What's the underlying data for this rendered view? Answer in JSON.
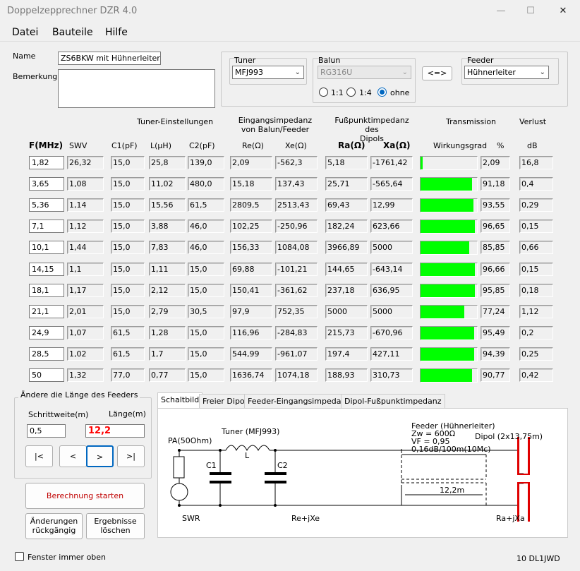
{
  "window": {
    "title": "Doppelzepprechner DZR 4.0",
    "min": "—",
    "max": "☐",
    "close": "✕"
  },
  "menu": [
    "Datei",
    "Bauteile",
    "Hilfe"
  ],
  "form": {
    "name_label": "Name",
    "name_value": "ZS6BKW mit Hühnerleiter.dzr",
    "remark_label": "Bemerkung",
    "remark_value": "",
    "tuner_label": "Tuner",
    "tuner_value": "MFJ993",
    "balun_label": "Balun",
    "balun_value": "RG316U",
    "balun_options": [
      "1:1",
      "1:4",
      "ohne"
    ],
    "balun_selected": "ohne",
    "swap_label": "<=>",
    "feeder_label": "Feeder",
    "feeder_value": "Hühnerleiter"
  },
  "group_headers": {
    "tuner": "Tuner-Einstellungen",
    "input_imp": "Eingangsimpedanz\nvon Balun/Feeder",
    "foot_imp": "Fußpunktimpedanz des\nDipols",
    "transmission": "Transmission",
    "loss": "Verlust"
  },
  "columns": [
    "F(MHz)",
    "SWV",
    "C1(pF)",
    "L(µH)",
    "C2(pF)",
    "Re(Ω)",
    "Xe(Ω)",
    "Ra(Ω)",
    "Xa(Ω)",
    "Wirkungsgrad",
    "%",
    "dB"
  ],
  "rows": [
    {
      "f": "1,82",
      "swv": "26,32",
      "c1": "15,0",
      "l": "25,8",
      "c2": "139,0",
      "re": "2,09",
      "xe": "-562,3",
      "ra": "5,18",
      "xa": "-1761,42",
      "eff": 2.09,
      "pct": "2,09",
      "db": "16,8"
    },
    {
      "f": "3,65",
      "swv": "1,08",
      "c1": "15,0",
      "l": "11,02",
      "c2": "480,0",
      "re": "15,18",
      "xe": "137,43",
      "ra": "25,71",
      "xa": "-565,64",
      "eff": 91.18,
      "pct": "91,18",
      "db": "0,4"
    },
    {
      "f": "5,36",
      "swv": "1,14",
      "c1": "15,0",
      "l": "15,56",
      "c2": "61,5",
      "re": "2809,5",
      "xe": "2513,43",
      "ra": "69,43",
      "xa": "12,99",
      "eff": 93.55,
      "pct": "93,55",
      "db": "0,29"
    },
    {
      "f": "7,1",
      "swv": "1,12",
      "c1": "15,0",
      "l": "3,88",
      "c2": "46,0",
      "re": "102,25",
      "xe": "-250,96",
      "ra": "182,24",
      "xa": "623,66",
      "eff": 96.65,
      "pct": "96,65",
      "db": "0,15"
    },
    {
      "f": "10,1",
      "swv": "1,44",
      "c1": "15,0",
      "l": "7,83",
      "c2": "46,0",
      "re": "156,33",
      "xe": "1084,08",
      "ra": "3966,89",
      "xa": "5000",
      "eff": 85.85,
      "pct": "85,85",
      "db": "0,66"
    },
    {
      "f": "14,15",
      "swv": "1,1",
      "c1": "15,0",
      "l": "1,11",
      "c2": "15,0",
      "re": "69,88",
      "xe": "-101,21",
      "ra": "144,65",
      "xa": "-643,14",
      "eff": 96.66,
      "pct": "96,66",
      "db": "0,15"
    },
    {
      "f": "18,1",
      "swv": "1,17",
      "c1": "15,0",
      "l": "2,12",
      "c2": "15,0",
      "re": "150,41",
      "xe": "-361,62",
      "ra": "237,18",
      "xa": "636,95",
      "eff": 95.85,
      "pct": "95,85",
      "db": "0,18"
    },
    {
      "f": "21,1",
      "swv": "2,01",
      "c1": "15,0",
      "l": "2,79",
      "c2": "30,5",
      "re": "97,9",
      "xe": "752,35",
      "ra": "5000",
      "xa": "5000",
      "eff": 77.24,
      "pct": "77,24",
      "db": "1,12"
    },
    {
      "f": "24,9",
      "swv": "1,07",
      "c1": "61,5",
      "l": "1,28",
      "c2": "15,0",
      "re": "116,96",
      "xe": "-284,83",
      "ra": "215,73",
      "xa": "-670,96",
      "eff": 95.49,
      "pct": "95,49",
      "db": "0,2"
    },
    {
      "f": "28,5",
      "swv": "1,02",
      "c1": "61,5",
      "l": "1,7",
      "c2": "15,0",
      "re": "544,99",
      "xe": "-961,07",
      "ra": "197,4",
      "xa": "427,11",
      "eff": 94.39,
      "pct": "94,39",
      "db": "0,25"
    },
    {
      "f": "50",
      "swv": "1,32",
      "c1": "77,0",
      "l": "0,77",
      "c2": "15,0",
      "re": "1636,74",
      "xe": "1074,18",
      "ra": "188,93",
      "xa": "310,73",
      "eff": 90.77,
      "pct": "90,77",
      "db": "0,42"
    }
  ],
  "feeder_length": {
    "group_label": "Ändere die Länge des Feeders",
    "step_label": "Schrittweite(m)",
    "step_value": "0,5",
    "length_label": "Länge(m)",
    "length_value": "12,2",
    "buttons": [
      "|<",
      "<",
      ">",
      ">|"
    ]
  },
  "actions": {
    "calc": "Berechnung starten",
    "undo": "Änderungen\nrückgängig",
    "clear": "Ergebnisse\nlöschen"
  },
  "tabs": [
    "Schaltbild",
    "Freier Dipol",
    "Feeder-Eingangsimpedanz",
    "Dipol-Fußpunktimpedanz"
  ],
  "schematic": {
    "pa": "PA(50Ohm)",
    "tuner": "Tuner (MFJ993)",
    "l": "L",
    "c1": "C1",
    "c2": "C2",
    "feeder": "Feeder (Hühnerleiter)",
    "zw": "Zw = 600Ω",
    "vf": "VF = 0,95",
    "loss": "0,16dB/100m(10Mc)",
    "dipol": "Dipol (2x13,75m)",
    "length": "12,2m",
    "swr": "SWR",
    "rexe": "Re+jXe",
    "raxa": "Ra+jXa"
  },
  "footer": {
    "always_on_top": "Fenster immer oben",
    "version": "10 DL1JWD"
  },
  "colors": {
    "bar": "#00ff00",
    "length_value": "#ff0000",
    "calc_text": "#c00000",
    "dipole": "#e00000"
  }
}
